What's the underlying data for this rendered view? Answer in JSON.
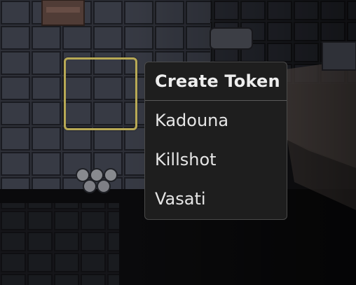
{
  "context_menu": {
    "title": "Create Token",
    "items": [
      {
        "label": "Kadouna"
      },
      {
        "label": "Killshot"
      },
      {
        "label": "Vasati"
      }
    ]
  },
  "colors": {
    "selection_border": "#b8a955",
    "menu_background": "#1e1e1e",
    "menu_text": "#e6e6e6"
  }
}
